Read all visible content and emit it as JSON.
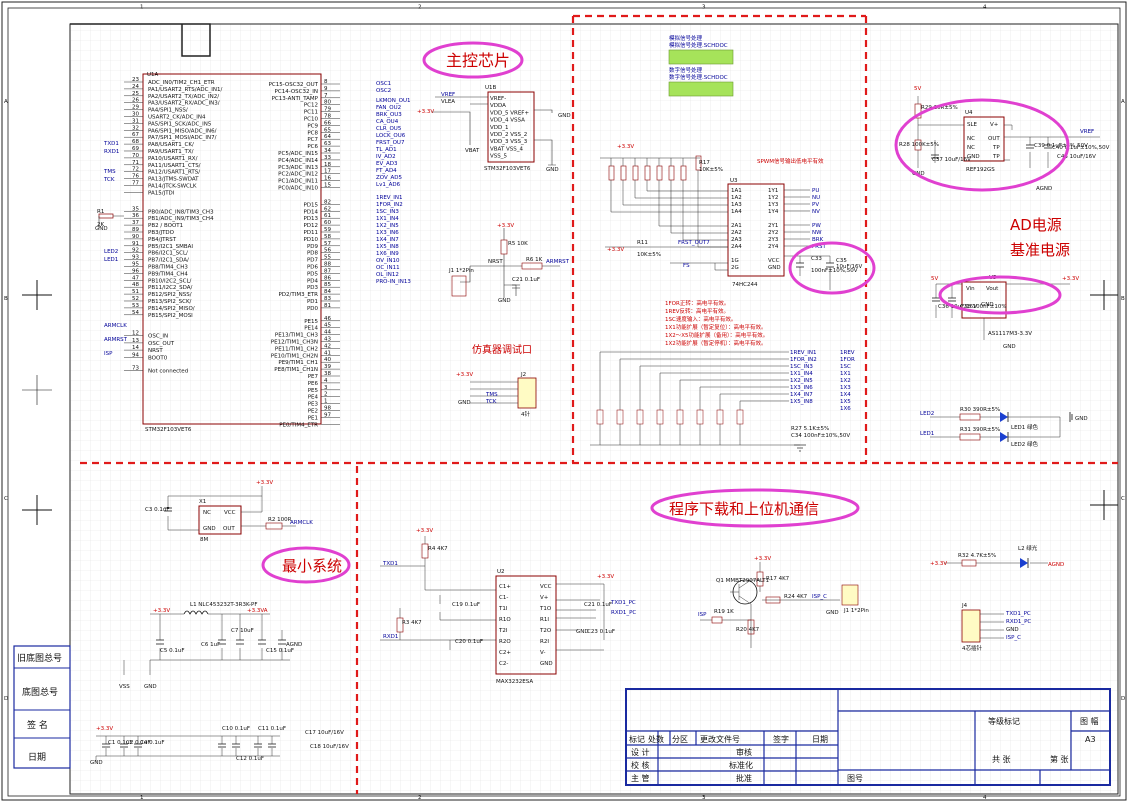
{
  "frame": {
    "col_numbers": [
      "1",
      "2",
      "3",
      "4"
    ],
    "row_letters": [
      "A",
      "B",
      "C",
      "D"
    ]
  },
  "sections": {
    "main_chip": "主控芯片",
    "min_system": "最小系统",
    "ad_power": "AD电源",
    "ref_power": "基准电源",
    "download": "程序下载和上位机通信",
    "debug_port": "仿真器调试口"
  },
  "sheet_symbols": [
    {
      "title": "模拟信号处理",
      "file": "模拟信号处理.SCHDOC"
    },
    {
      "title": "数字信号处理",
      "file": "数字信号处理.SCHDOC"
    }
  ],
  "mcu": {
    "designator": "U1A",
    "part": "STM32F103VET6",
    "left_pins": [
      {
        "n": "23",
        "name": "ADC_IN0/TIM2_CH1_ETR"
      },
      {
        "n": "24",
        "name": "PA1/USART2_RTS/ADC_IN1/"
      },
      {
        "n": "25",
        "name": "PA2/USART2_TX/ADC_IN2/"
      },
      {
        "n": "26",
        "name": "PA3/USART2_RX/ADC_IN3/"
      },
      {
        "n": "29",
        "name": "PA4/SPI1_NSS/"
      },
      {
        "n": "30",
        "name": "USART2_CK/ADC_IN4"
      },
      {
        "n": "31",
        "name": "PA5/SPI1_SCK/ADC_IN5"
      },
      {
        "n": "32",
        "name": "PA6/SPI1_MISO/ADC_IN6/"
      },
      {
        "n": "67",
        "name": "PA7/SPI1_MOSI/ADC_IN7/"
      },
      {
        "n": "68",
        "name": "PA8/USART1_CK/"
      },
      {
        "n": "69",
        "name": "PA9/USART1_TX/"
      },
      {
        "n": "70",
        "name": "PA10/USART1_RX/"
      },
      {
        "n": "71",
        "name": "PA11/USART1_CTS/"
      },
      {
        "n": "72",
        "name": "PA12/USART1_RTS/"
      },
      {
        "n": "76",
        "name": "PA13/JTMS-SWDAT"
      },
      {
        "n": "77",
        "name": "PA14/JTCK-SWCLK"
      },
      {
        "n": "",
        "name": "PA15/JTDI"
      },
      {
        "n": "35",
        "name": "PB0/ADC_IN8/TIM3_CH3"
      },
      {
        "n": "36",
        "name": "PB1/ADC_IN9/TIM3_CH4"
      },
      {
        "n": "37",
        "name": "PB2 / BOOT1"
      },
      {
        "n": "89",
        "name": "PB3/JTDO"
      },
      {
        "n": "90",
        "name": "PB4/JTRST"
      },
      {
        "n": "91",
        "name": "PB5/I2C1_SMBAI"
      },
      {
        "n": "92",
        "name": "PB6/I2C1_SCL/"
      },
      {
        "n": "93",
        "name": "PB7/I2C1_SDA/"
      },
      {
        "n": "95",
        "name": "PB8/TIM4_CH3"
      },
      {
        "n": "96",
        "name": "PB9/TIM4_CH4"
      },
      {
        "n": "47",
        "name": "PB10/I2C2_SCL/"
      },
      {
        "n": "48",
        "name": "PB11/I2C2_SDA/"
      },
      {
        "n": "51",
        "name": "PB12/SPI2_NSS/"
      },
      {
        "n": "52",
        "name": "PB13/SPI2_SCK/"
      },
      {
        "n": "53",
        "name": "PB14/SPI2_MISO/"
      },
      {
        "n": "54",
        "name": "PB15/SPI2_MOSI"
      },
      {
        "n": "12",
        "name": "OSC_IN"
      },
      {
        "n": "13",
        "name": "OSC_OUT"
      },
      {
        "n": "14",
        "name": "NRST"
      },
      {
        "n": "94",
        "name": "BOOT0"
      },
      {
        "n": "73",
        "name": "Not connected"
      }
    ],
    "right_pins": [
      {
        "n": "8",
        "name": "PC15-OSC32_OUT"
      },
      {
        "n": "9",
        "name": "PC14-OSC32_IN"
      },
      {
        "n": "7",
        "name": "PC13-ANTI_TAMP"
      },
      {
        "n": "80",
        "name": "PC12"
      },
      {
        "n": "79",
        "name": "PC11"
      },
      {
        "n": "78",
        "name": "PC10"
      },
      {
        "n": "66",
        "name": "PC9"
      },
      {
        "n": "65",
        "name": "PC8"
      },
      {
        "n": "64",
        "name": "PC7"
      },
      {
        "n": "63",
        "name": "PC6"
      },
      {
        "n": "34",
        "name": "PC5/ADC_IN15"
      },
      {
        "n": "33",
        "name": "PC4/ADC_IN14"
      },
      {
        "n": "18",
        "name": "PC3/ADC_IN13"
      },
      {
        "n": "17",
        "name": "PC2/ADC_IN12"
      },
      {
        "n": "16",
        "name": "PC1/ADC_IN11"
      },
      {
        "n": "15",
        "name": "PC0/ADC_IN10"
      },
      {
        "n": "82",
        "name": "PD15"
      },
      {
        "n": "62",
        "name": "PD14"
      },
      {
        "n": "61",
        "name": "PD13"
      },
      {
        "n": "60",
        "name": "PD12"
      },
      {
        "n": "59",
        "name": "PD11"
      },
      {
        "n": "58",
        "name": "PD10"
      },
      {
        "n": "57",
        "name": "PD9"
      },
      {
        "n": "56",
        "name": "PD8"
      },
      {
        "n": "55",
        "name": "PD7"
      },
      {
        "n": "88",
        "name": "PD6"
      },
      {
        "n": "87",
        "name": "PD5"
      },
      {
        "n": "86",
        "name": "PD4"
      },
      {
        "n": "85",
        "name": "PD3"
      },
      {
        "n": "84",
        "name": "PD2/TIM3_ETR"
      },
      {
        "n": "83",
        "name": "PD1"
      },
      {
        "n": "81",
        "name": "PD0"
      },
      {
        "n": "46",
        "name": "PE15"
      },
      {
        "n": "45",
        "name": "PE14"
      },
      {
        "n": "44",
        "name": "PE13/TIM1_CH3"
      },
      {
        "n": "43",
        "name": "PE12/TIM1_CH3N"
      },
      {
        "n": "42",
        "name": "PE11/TIM1_CH2"
      },
      {
        "n": "41",
        "name": "PE10/TIM1_CH2N"
      },
      {
        "n": "40",
        "name": "PE9/TIM1_CH1"
      },
      {
        "n": "39",
        "name": "PE8/TIM1_CH1N"
      },
      {
        "n": "38",
        "name": "PE7"
      },
      {
        "n": "4",
        "name": "PE6"
      },
      {
        "n": "3",
        "name": "PE5"
      },
      {
        "n": "2",
        "name": "PE4"
      },
      {
        "n": "1",
        "name": "PE3"
      },
      {
        "n": "98",
        "name": "PE2"
      },
      {
        "n": "97",
        "name": "PE1"
      },
      {
        "n": "",
        "name": "PE0/TIM4_ETR"
      }
    ],
    "left_nets": [
      "TXD1",
      "RXD1",
      "TMS",
      "TCK",
      "LED2",
      "LED1",
      "ARMCLK",
      "ARMRST",
      "ISP"
    ],
    "right_nets": [
      "OSC1",
      "OSC2",
      "LKMON_OU1",
      "FAN_OU2",
      "BRK_OU3",
      "CA_OU4",
      "CLR_OU5",
      "LOCK_OU6",
      "FRST_OU7",
      "TL_AD1",
      "IV_AD2",
      "EV_AD3",
      "FT_AD4",
      "ZOV_AD5",
      "Lv1_AD6",
      "1REV_IN1",
      "1FOR_IN2",
      "1SC_IN3",
      "1X1_IN4",
      "1X2_IN5",
      "1X3_IN6",
      "1X4_IN7",
      "1X5_IN8",
      "1X6_IN9",
      "OV_IN10",
      "OC_IN11",
      "OL_IN12",
      "PRO-IN_IN13"
    ]
  },
  "power_ic": {
    "designator": "U1B",
    "part": "STM32F103VET6",
    "pins": [
      "VREF-",
      "VDDA",
      "VDD_5 VREF+",
      "VDD_4 VSSA",
      "VDD_1",
      "VDD_2 VSS_2",
      "VDD_3 VSS_3",
      "VBAT VSS_4",
      "VSS_5"
    ],
    "nets": [
      "VREF",
      "+3.3V",
      "GND",
      "VBAT"
    ],
    "labels": [
      "VLEA",
      "VLEB"
    ]
  },
  "spwm": {
    "title": "SPWM信号输出低电平有效",
    "designator": "U3",
    "part": "74HC244",
    "pins_left": [
      "1A1",
      "1A2",
      "1A3",
      "1A4",
      "2A1",
      "2A2",
      "2A3",
      "2A4",
      "1G",
      "2G"
    ],
    "pins_right": [
      "1Y1",
      "1Y2",
      "1Y3",
      "1Y4",
      "2Y1",
      "2Y2",
      "2Y3",
      "2Y4",
      "VCC",
      "GND"
    ],
    "outputs": [
      "PU",
      "NU",
      "PV",
      "NV",
      "PW",
      "NW",
      "BRK",
      "FRST"
    ],
    "notes": [
      "1FOR正转：高电平有效。",
      "1REV反转：高电平有效。",
      "1SC速度输入：高电平有效。",
      "1X1功能扩展（暂定复位）：高电平有效。",
      "1X2～X5功能扩展（备用）：高电平有效。",
      "1X2功能扩展（暂定停机）：高电平有效。"
    ],
    "in_nets": [
      "1REV_IN1",
      "1FOR_IN2",
      "1SC_IN3",
      "1X1_IN4",
      "1X2_IN5",
      "1X3_IN6",
      "1X4_IN7",
      "1X5_IN8"
    ],
    "out_nets": [
      "1REV",
      "1FOR",
      "1SC",
      "1X1",
      "1X2",
      "1X3",
      "1X4",
      "1X5",
      "1X6"
    ],
    "resistor": "R27 5.1K±5%",
    "cap": "C34 100nF±10%,50V"
  },
  "ref": {
    "designator": "U4",
    "part": "REF192GS",
    "pins": [
      "SLE",
      "V+",
      "NC",
      "OUT",
      "NC",
      "TP",
      "GND",
      "TP"
    ],
    "parts": [
      "R29 20R±5%",
      "R28 100K±5%",
      "C37 10uF/16V",
      "C39 0.1uF±5%,50V",
      "C40 0.1uF±10%,50V",
      "C43 10uF/16V"
    ],
    "nets": [
      "5V",
      "VREF",
      "GND",
      "AGND"
    ]
  },
  "ldo": {
    "designator": "U5",
    "part": "AS1117M3-3.3V",
    "pins": [
      "Vin",
      "Vout",
      "GND"
    ],
    "parts": [
      "C36 10uF/16V",
      "C38 100nF±10%"
    ],
    "nets": [
      "5V",
      "+3.3V",
      "GND"
    ]
  },
  "leds": {
    "parts": [
      "R30 390R±5%",
      "R31 390R±5%",
      "LED1 绿色",
      "LED2 绿色"
    ],
    "nets": [
      "LED2",
      "LED1",
      "GND"
    ]
  },
  "osc": {
    "designator": "X1",
    "value": "8M",
    "pins": [
      "NC",
      "VCC",
      "GND",
      "OUT"
    ],
    "parts": [
      "C3 0.1uF",
      "R2 100R"
    ],
    "nets": [
      "+3.3V",
      "ARMCLK",
      "GND"
    ]
  },
  "rs232": {
    "designator": "U2",
    "part": "MAX3232ESA",
    "pins_left": [
      "C1+",
      "C1-",
      "T1I",
      "R1O",
      "T2I",
      "R2O",
      "C2+",
      "C2-"
    ],
    "pins_right": [
      "VCC",
      "V+",
      "T1O",
      "R1I",
      "T2O",
      "R2I",
      "V-",
      "GND"
    ],
    "parts": [
      "R4 4K7",
      "R3 4K7",
      "C19 0.1uF",
      "C20 0.1uF",
      "C21 0.1uF",
      "C22 0.1uF",
      "C23 0.1uF"
    ],
    "nets": [
      "+3.3V",
      "TXD1",
      "RXD1",
      "TXD1_PC",
      "RXD1_PC",
      "GND"
    ]
  },
  "isp": {
    "parts": [
      "Q1 MMBT2907ALT1",
      "R17 4K7",
      "R24 4K7",
      "R19 1K",
      "R20 4K7",
      "J1 1*2Pin"
    ],
    "nets": [
      "+3.3V",
      "ISP",
      "ISP_C",
      "GND"
    ]
  },
  "connector_j4": {
    "designator": "J4",
    "label": "4芯插针",
    "pins": [
      "TXD1_PC",
      "RXD1_PC",
      "GND",
      "ISP_C"
    ]
  },
  "power_led": {
    "parts": [
      "R32 4.7K±5%",
      "L2 绿光"
    ],
    "nets": [
      "+3.3V",
      "AGND"
    ]
  },
  "filter": {
    "parts": [
      "L1 NLC453232T-3R3K-PF",
      "C5 0.1uF",
      "C6 1uF",
      "C7 10uF",
      "C8 10uF",
      "C15 0.1uF"
    ],
    "nets": [
      "+3.3V",
      "+3.3VA",
      "AGND",
      "VSS",
      "GND"
    ]
  },
  "debug_conn": {
    "designator": "J2",
    "label": "4针",
    "nets": [
      "+3.3V",
      "TMS",
      "TCK",
      "GND"
    ]
  },
  "reset": {
    "parts": [
      "R5 10K",
      "R6 1K",
      "C21 0.1uF",
      "J1 1*2Pin"
    ],
    "nets": [
      "+3.3V",
      "NRST",
      "ARMRST",
      "GND"
    ]
  },
  "bottom_caps": {
    "parts": [
      "C1 0.1uF",
      "C2 0.1uF",
      "C4 0.1uF",
      "C10 0.1uF",
      "C11 0.1uF",
      "C12 0.1uF",
      "C17 10uF/16V",
      "C18 10uF/16V",
      "C16 0.1uF"
    ],
    "nets": [
      "+3.3V",
      "GND"
    ]
  },
  "side_labels": [
    "旧底图总号",
    "底图总号",
    "签  名",
    "日期"
  ],
  "title_block": {
    "rev_headers": [
      "标记",
      "处数",
      "分区",
      "更改文件号",
      "签字",
      "日期"
    ],
    "rows": [
      "设  计",
      "校  核",
      "主  管"
    ],
    "approve": [
      "审核",
      "标准化",
      "批准"
    ],
    "grade": "等级标记",
    "size_label": "图 幅",
    "size": "A3",
    "total": "共      张",
    "sheet": "第      张",
    "drawing_no": "图号"
  }
}
